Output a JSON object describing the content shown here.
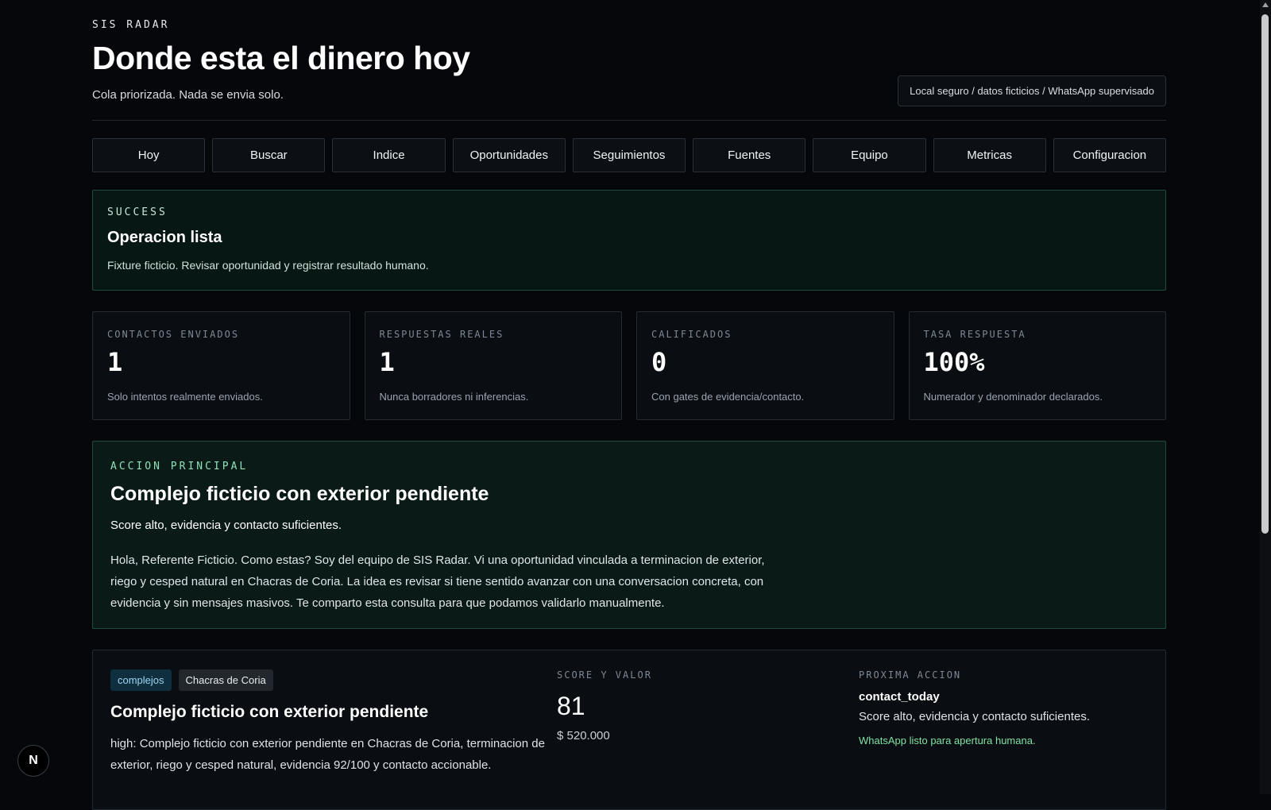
{
  "header": {
    "eyebrow": "SIS RADAR",
    "title": "Donde esta el dinero hoy",
    "subtitle": "Cola priorizada. Nada se envia solo.",
    "mode_badge": "Local seguro / datos ficticios / WhatsApp supervisado"
  },
  "nav": {
    "tabs": [
      "Hoy",
      "Buscar",
      "Indice",
      "Oportunidades",
      "Seguimientos",
      "Fuentes",
      "Equipo",
      "Metricas",
      "Configuracion"
    ]
  },
  "banner": {
    "eyebrow": "SUCCESS",
    "title": "Operacion lista",
    "message": "Fixture ficticio. Revisar oportunidad y registrar resultado humano."
  },
  "stats": [
    {
      "label": "CONTACTOS ENVIADOS",
      "value": "1",
      "note": "Solo intentos realmente enviados."
    },
    {
      "label": "RESPUESTAS REALES",
      "value": "1",
      "note": "Nunca borradores ni inferencias."
    },
    {
      "label": "CALIFICADOS",
      "value": "0",
      "note": "Con gates de evidencia/contacto."
    },
    {
      "label": "TASA RESPUESTA",
      "value": "100%",
      "note": "Numerador y denominador declarados."
    }
  ],
  "main_action": {
    "eyebrow": "ACCION PRINCIPAL",
    "title": "Complejo ficticio con exterior pendiente",
    "reason": "Score alto, evidencia y contacto suficientes.",
    "message": "Hola, Referente Ficticio. Como estas? Soy del equipo de SIS Radar. Vi una oportunidad vinculada a terminacion de exterior, riego y cesped natural en Chacras de Coria. La idea es revisar si tiene sentido avanzar con una conversacion concreta, con evidencia y sin mensajes masivos. Te comparto esta consulta para que podamos validarlo manualmente."
  },
  "opportunity": {
    "tags": [
      "complejos",
      "Chacras de Coria"
    ],
    "title": "Complejo ficticio con exterior pendiente",
    "summary": "high: Complejo ficticio con exterior pendiente en Chacras de Coria, terminacion de exterior, riego y cesped natural, evidencia 92/100 y contacto accionable.",
    "score_label": "SCORE Y VALOR",
    "score": "81",
    "value": "$ 520.000",
    "next_label": "PROXIMA ACCION",
    "next_code": "contact_today",
    "next_reason": "Score alto, evidencia y contacto suficientes.",
    "next_status": "WhatsApp listo para apertura humana."
  },
  "dev_badge": "N",
  "colors": {
    "background": "#05070a",
    "success_border": "#1c4a3c",
    "accent_green": "#7fe3a4",
    "tag_blue": "#9fd4f0"
  }
}
